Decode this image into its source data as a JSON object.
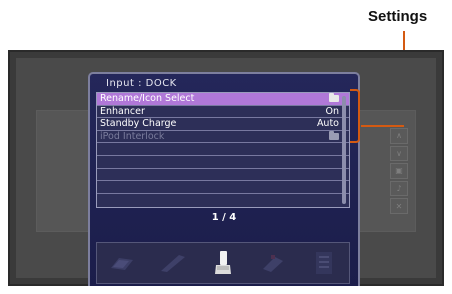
{
  "callout": {
    "label": "Settings"
  },
  "osd": {
    "title": "Input : DOCK",
    "rows": [
      {
        "label": "Rename/Icon Select",
        "value": "",
        "icon": "folder-icon",
        "state": "selected"
      },
      {
        "label": "Enhancer",
        "value": "On",
        "icon": "",
        "state": "normal"
      },
      {
        "label": "Standby Charge",
        "value": "Auto",
        "icon": "",
        "state": "normal"
      },
      {
        "label": "iPod Interlock",
        "value": "",
        "icon": "folder-icon",
        "state": "disabled"
      },
      {
        "label": "",
        "value": "",
        "icon": "",
        "state": "empty"
      },
      {
        "label": "",
        "value": "",
        "icon": "",
        "state": "empty"
      },
      {
        "label": "",
        "value": "",
        "icon": "",
        "state": "empty"
      },
      {
        "label": "",
        "value": "",
        "icon": "",
        "state": "empty"
      },
      {
        "label": "",
        "value": "",
        "icon": "",
        "state": "empty"
      }
    ],
    "page_indicator": "1 / 4",
    "tabs": [
      {
        "icon": "speaker-icon",
        "active": false
      },
      {
        "icon": "pencil-icon",
        "active": false
      },
      {
        "icon": "dock-icon",
        "active": true
      },
      {
        "icon": "cable-icon",
        "active": false
      },
      {
        "icon": "list-icon",
        "active": false
      }
    ]
  },
  "colors": {
    "callout": "#d45a12",
    "selected_row": "#b078d8",
    "osd_background": "#24275a"
  }
}
